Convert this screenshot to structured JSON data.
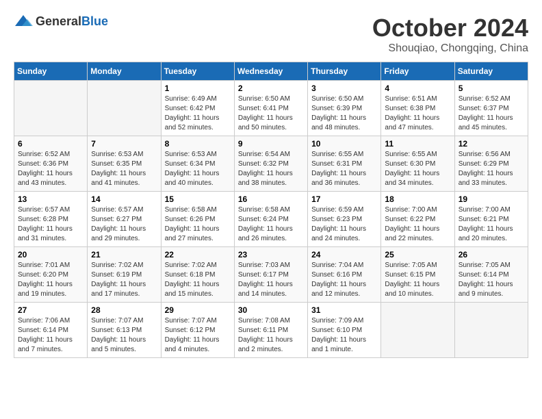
{
  "logo": {
    "general": "General",
    "blue": "Blue"
  },
  "title": "October 2024",
  "location": "Shouqiao, Chongqing, China",
  "headers": [
    "Sunday",
    "Monday",
    "Tuesday",
    "Wednesday",
    "Thursday",
    "Friday",
    "Saturday"
  ],
  "weeks": [
    [
      {
        "day": "",
        "sunrise": "",
        "sunset": "",
        "daylight": ""
      },
      {
        "day": "",
        "sunrise": "",
        "sunset": "",
        "daylight": ""
      },
      {
        "day": "1",
        "sunrise": "Sunrise: 6:49 AM",
        "sunset": "Sunset: 6:42 PM",
        "daylight": "Daylight: 11 hours and 52 minutes."
      },
      {
        "day": "2",
        "sunrise": "Sunrise: 6:50 AM",
        "sunset": "Sunset: 6:41 PM",
        "daylight": "Daylight: 11 hours and 50 minutes."
      },
      {
        "day": "3",
        "sunrise": "Sunrise: 6:50 AM",
        "sunset": "Sunset: 6:39 PM",
        "daylight": "Daylight: 11 hours and 48 minutes."
      },
      {
        "day": "4",
        "sunrise": "Sunrise: 6:51 AM",
        "sunset": "Sunset: 6:38 PM",
        "daylight": "Daylight: 11 hours and 47 minutes."
      },
      {
        "day": "5",
        "sunrise": "Sunrise: 6:52 AM",
        "sunset": "Sunset: 6:37 PM",
        "daylight": "Daylight: 11 hours and 45 minutes."
      }
    ],
    [
      {
        "day": "6",
        "sunrise": "Sunrise: 6:52 AM",
        "sunset": "Sunset: 6:36 PM",
        "daylight": "Daylight: 11 hours and 43 minutes."
      },
      {
        "day": "7",
        "sunrise": "Sunrise: 6:53 AM",
        "sunset": "Sunset: 6:35 PM",
        "daylight": "Daylight: 11 hours and 41 minutes."
      },
      {
        "day": "8",
        "sunrise": "Sunrise: 6:53 AM",
        "sunset": "Sunset: 6:34 PM",
        "daylight": "Daylight: 11 hours and 40 minutes."
      },
      {
        "day": "9",
        "sunrise": "Sunrise: 6:54 AM",
        "sunset": "Sunset: 6:32 PM",
        "daylight": "Daylight: 11 hours and 38 minutes."
      },
      {
        "day": "10",
        "sunrise": "Sunrise: 6:55 AM",
        "sunset": "Sunset: 6:31 PM",
        "daylight": "Daylight: 11 hours and 36 minutes."
      },
      {
        "day": "11",
        "sunrise": "Sunrise: 6:55 AM",
        "sunset": "Sunset: 6:30 PM",
        "daylight": "Daylight: 11 hours and 34 minutes."
      },
      {
        "day": "12",
        "sunrise": "Sunrise: 6:56 AM",
        "sunset": "Sunset: 6:29 PM",
        "daylight": "Daylight: 11 hours and 33 minutes."
      }
    ],
    [
      {
        "day": "13",
        "sunrise": "Sunrise: 6:57 AM",
        "sunset": "Sunset: 6:28 PM",
        "daylight": "Daylight: 11 hours and 31 minutes."
      },
      {
        "day": "14",
        "sunrise": "Sunrise: 6:57 AM",
        "sunset": "Sunset: 6:27 PM",
        "daylight": "Daylight: 11 hours and 29 minutes."
      },
      {
        "day": "15",
        "sunrise": "Sunrise: 6:58 AM",
        "sunset": "Sunset: 6:26 PM",
        "daylight": "Daylight: 11 hours and 27 minutes."
      },
      {
        "day": "16",
        "sunrise": "Sunrise: 6:58 AM",
        "sunset": "Sunset: 6:24 PM",
        "daylight": "Daylight: 11 hours and 26 minutes."
      },
      {
        "day": "17",
        "sunrise": "Sunrise: 6:59 AM",
        "sunset": "Sunset: 6:23 PM",
        "daylight": "Daylight: 11 hours and 24 minutes."
      },
      {
        "day": "18",
        "sunrise": "Sunrise: 7:00 AM",
        "sunset": "Sunset: 6:22 PM",
        "daylight": "Daylight: 11 hours and 22 minutes."
      },
      {
        "day": "19",
        "sunrise": "Sunrise: 7:00 AM",
        "sunset": "Sunset: 6:21 PM",
        "daylight": "Daylight: 11 hours and 20 minutes."
      }
    ],
    [
      {
        "day": "20",
        "sunrise": "Sunrise: 7:01 AM",
        "sunset": "Sunset: 6:20 PM",
        "daylight": "Daylight: 11 hours and 19 minutes."
      },
      {
        "day": "21",
        "sunrise": "Sunrise: 7:02 AM",
        "sunset": "Sunset: 6:19 PM",
        "daylight": "Daylight: 11 hours and 17 minutes."
      },
      {
        "day": "22",
        "sunrise": "Sunrise: 7:02 AM",
        "sunset": "Sunset: 6:18 PM",
        "daylight": "Daylight: 11 hours and 15 minutes."
      },
      {
        "day": "23",
        "sunrise": "Sunrise: 7:03 AM",
        "sunset": "Sunset: 6:17 PM",
        "daylight": "Daylight: 11 hours and 14 minutes."
      },
      {
        "day": "24",
        "sunrise": "Sunrise: 7:04 AM",
        "sunset": "Sunset: 6:16 PM",
        "daylight": "Daylight: 11 hours and 12 minutes."
      },
      {
        "day": "25",
        "sunrise": "Sunrise: 7:05 AM",
        "sunset": "Sunset: 6:15 PM",
        "daylight": "Daylight: 11 hours and 10 minutes."
      },
      {
        "day": "26",
        "sunrise": "Sunrise: 7:05 AM",
        "sunset": "Sunset: 6:14 PM",
        "daylight": "Daylight: 11 hours and 9 minutes."
      }
    ],
    [
      {
        "day": "27",
        "sunrise": "Sunrise: 7:06 AM",
        "sunset": "Sunset: 6:14 PM",
        "daylight": "Daylight: 11 hours and 7 minutes."
      },
      {
        "day": "28",
        "sunrise": "Sunrise: 7:07 AM",
        "sunset": "Sunset: 6:13 PM",
        "daylight": "Daylight: 11 hours and 5 minutes."
      },
      {
        "day": "29",
        "sunrise": "Sunrise: 7:07 AM",
        "sunset": "Sunset: 6:12 PM",
        "daylight": "Daylight: 11 hours and 4 minutes."
      },
      {
        "day": "30",
        "sunrise": "Sunrise: 7:08 AM",
        "sunset": "Sunset: 6:11 PM",
        "daylight": "Daylight: 11 hours and 2 minutes."
      },
      {
        "day": "31",
        "sunrise": "Sunrise: 7:09 AM",
        "sunset": "Sunset: 6:10 PM",
        "daylight": "Daylight: 11 hours and 1 minute."
      },
      {
        "day": "",
        "sunrise": "",
        "sunset": "",
        "daylight": ""
      },
      {
        "day": "",
        "sunrise": "",
        "sunset": "",
        "daylight": ""
      }
    ]
  ]
}
